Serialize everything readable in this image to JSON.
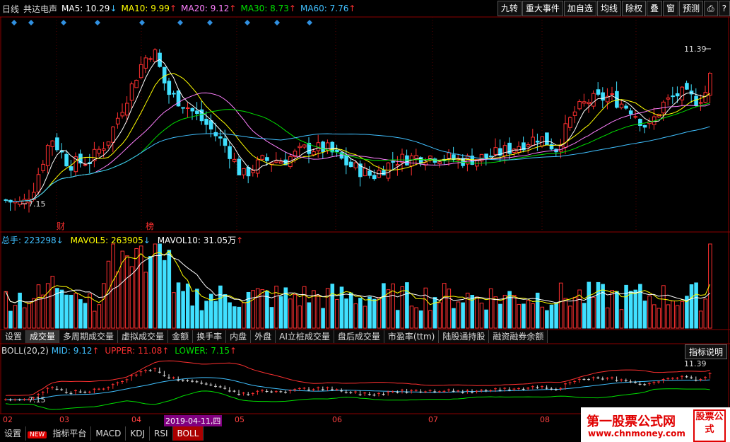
{
  "header": {
    "period": "日线",
    "stock_name": "共达电声",
    "ma5_label": "MA5: 10.29",
    "ma10_label": "MA10: 9.99",
    "ma20_label": "MA20: 9.12",
    "ma30_label": "MA30: 8.73",
    "ma60_label": "MA60: 7.76"
  },
  "toolbar": {
    "items": [
      "九转",
      "重大事件",
      "加自选",
      "均线",
      "除权",
      "叠",
      "窗",
      "预测",
      "⎙",
      "?"
    ]
  },
  "colors": {
    "up": "#ff3030",
    "down": "#40e0ff",
    "ma5": "#ffffff",
    "ma10": "#ffff00",
    "ma20": "#ff80ff",
    "ma30": "#00e000",
    "ma60": "#40c0ff",
    "boll_upper": "#ff3030",
    "boll_mid": "#40c0ff",
    "boll_lower": "#00e000"
  },
  "price_chart": {
    "high_label": "11.39",
    "low_label": "7.15",
    "marker_cai": "财",
    "marker_bang": "榜"
  },
  "volume_panel": {
    "total_label": "总手: 223298",
    "mavol5_label": "MAVOL5: 263905",
    "mavol10_label": "MAVOL10: 31.05万"
  },
  "indicator_tabs": [
    "设置",
    "成交量",
    "多周期成交量",
    "虚拟成交量",
    "金额",
    "换手率",
    "内盘",
    "外盘",
    "AI立桩成交量",
    "盘后成交量",
    "市盈率(ttm)",
    "陆股通持股",
    "融资融券余额"
  ],
  "boll_panel": {
    "title": "BOLL(20,2)",
    "mid_label": "MID: 9.12",
    "upper_label": "UPPER: 11.08",
    "lower_label": "LOWER: 7.15",
    "high_label": "11.39",
    "low_label": "7.15",
    "help_button": "指标说明"
  },
  "date_axis": {
    "labels": [
      "02",
      "03",
      "04",
      "2019-04-11,四",
      "05",
      "06",
      "07",
      "08"
    ]
  },
  "bottom_tabs": [
    "设置",
    "NEW",
    "指标平台",
    "MACD",
    "KDJ",
    "RSI",
    "BOLL"
  ],
  "brand": {
    "title": "第一股票公式网",
    "url": "www.chnmoney.com",
    "box": "股票公式"
  }
}
